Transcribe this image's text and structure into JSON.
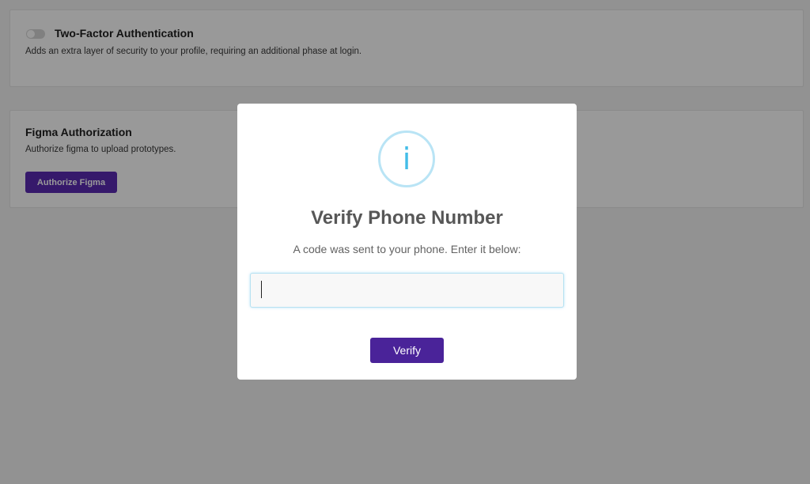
{
  "two_factor": {
    "title": "Two-Factor Authentication",
    "description": "Adds an extra layer of security to your profile, requiring an additional phase at login.",
    "enabled": false
  },
  "figma": {
    "title": "Figma Authorization",
    "description": "Authorize figma to upload prototypes.",
    "button_label": "Authorize Figma"
  },
  "modal": {
    "icon": "info-icon",
    "icon_glyph": "i",
    "title": "Verify Phone Number",
    "message": "A code was sent to your phone. Enter it below:",
    "input_value": "",
    "verify_label": "Verify"
  },
  "colors": {
    "primary": "#4a2399",
    "info_accent": "#43bde8",
    "info_ring": "#b9e4f5"
  }
}
